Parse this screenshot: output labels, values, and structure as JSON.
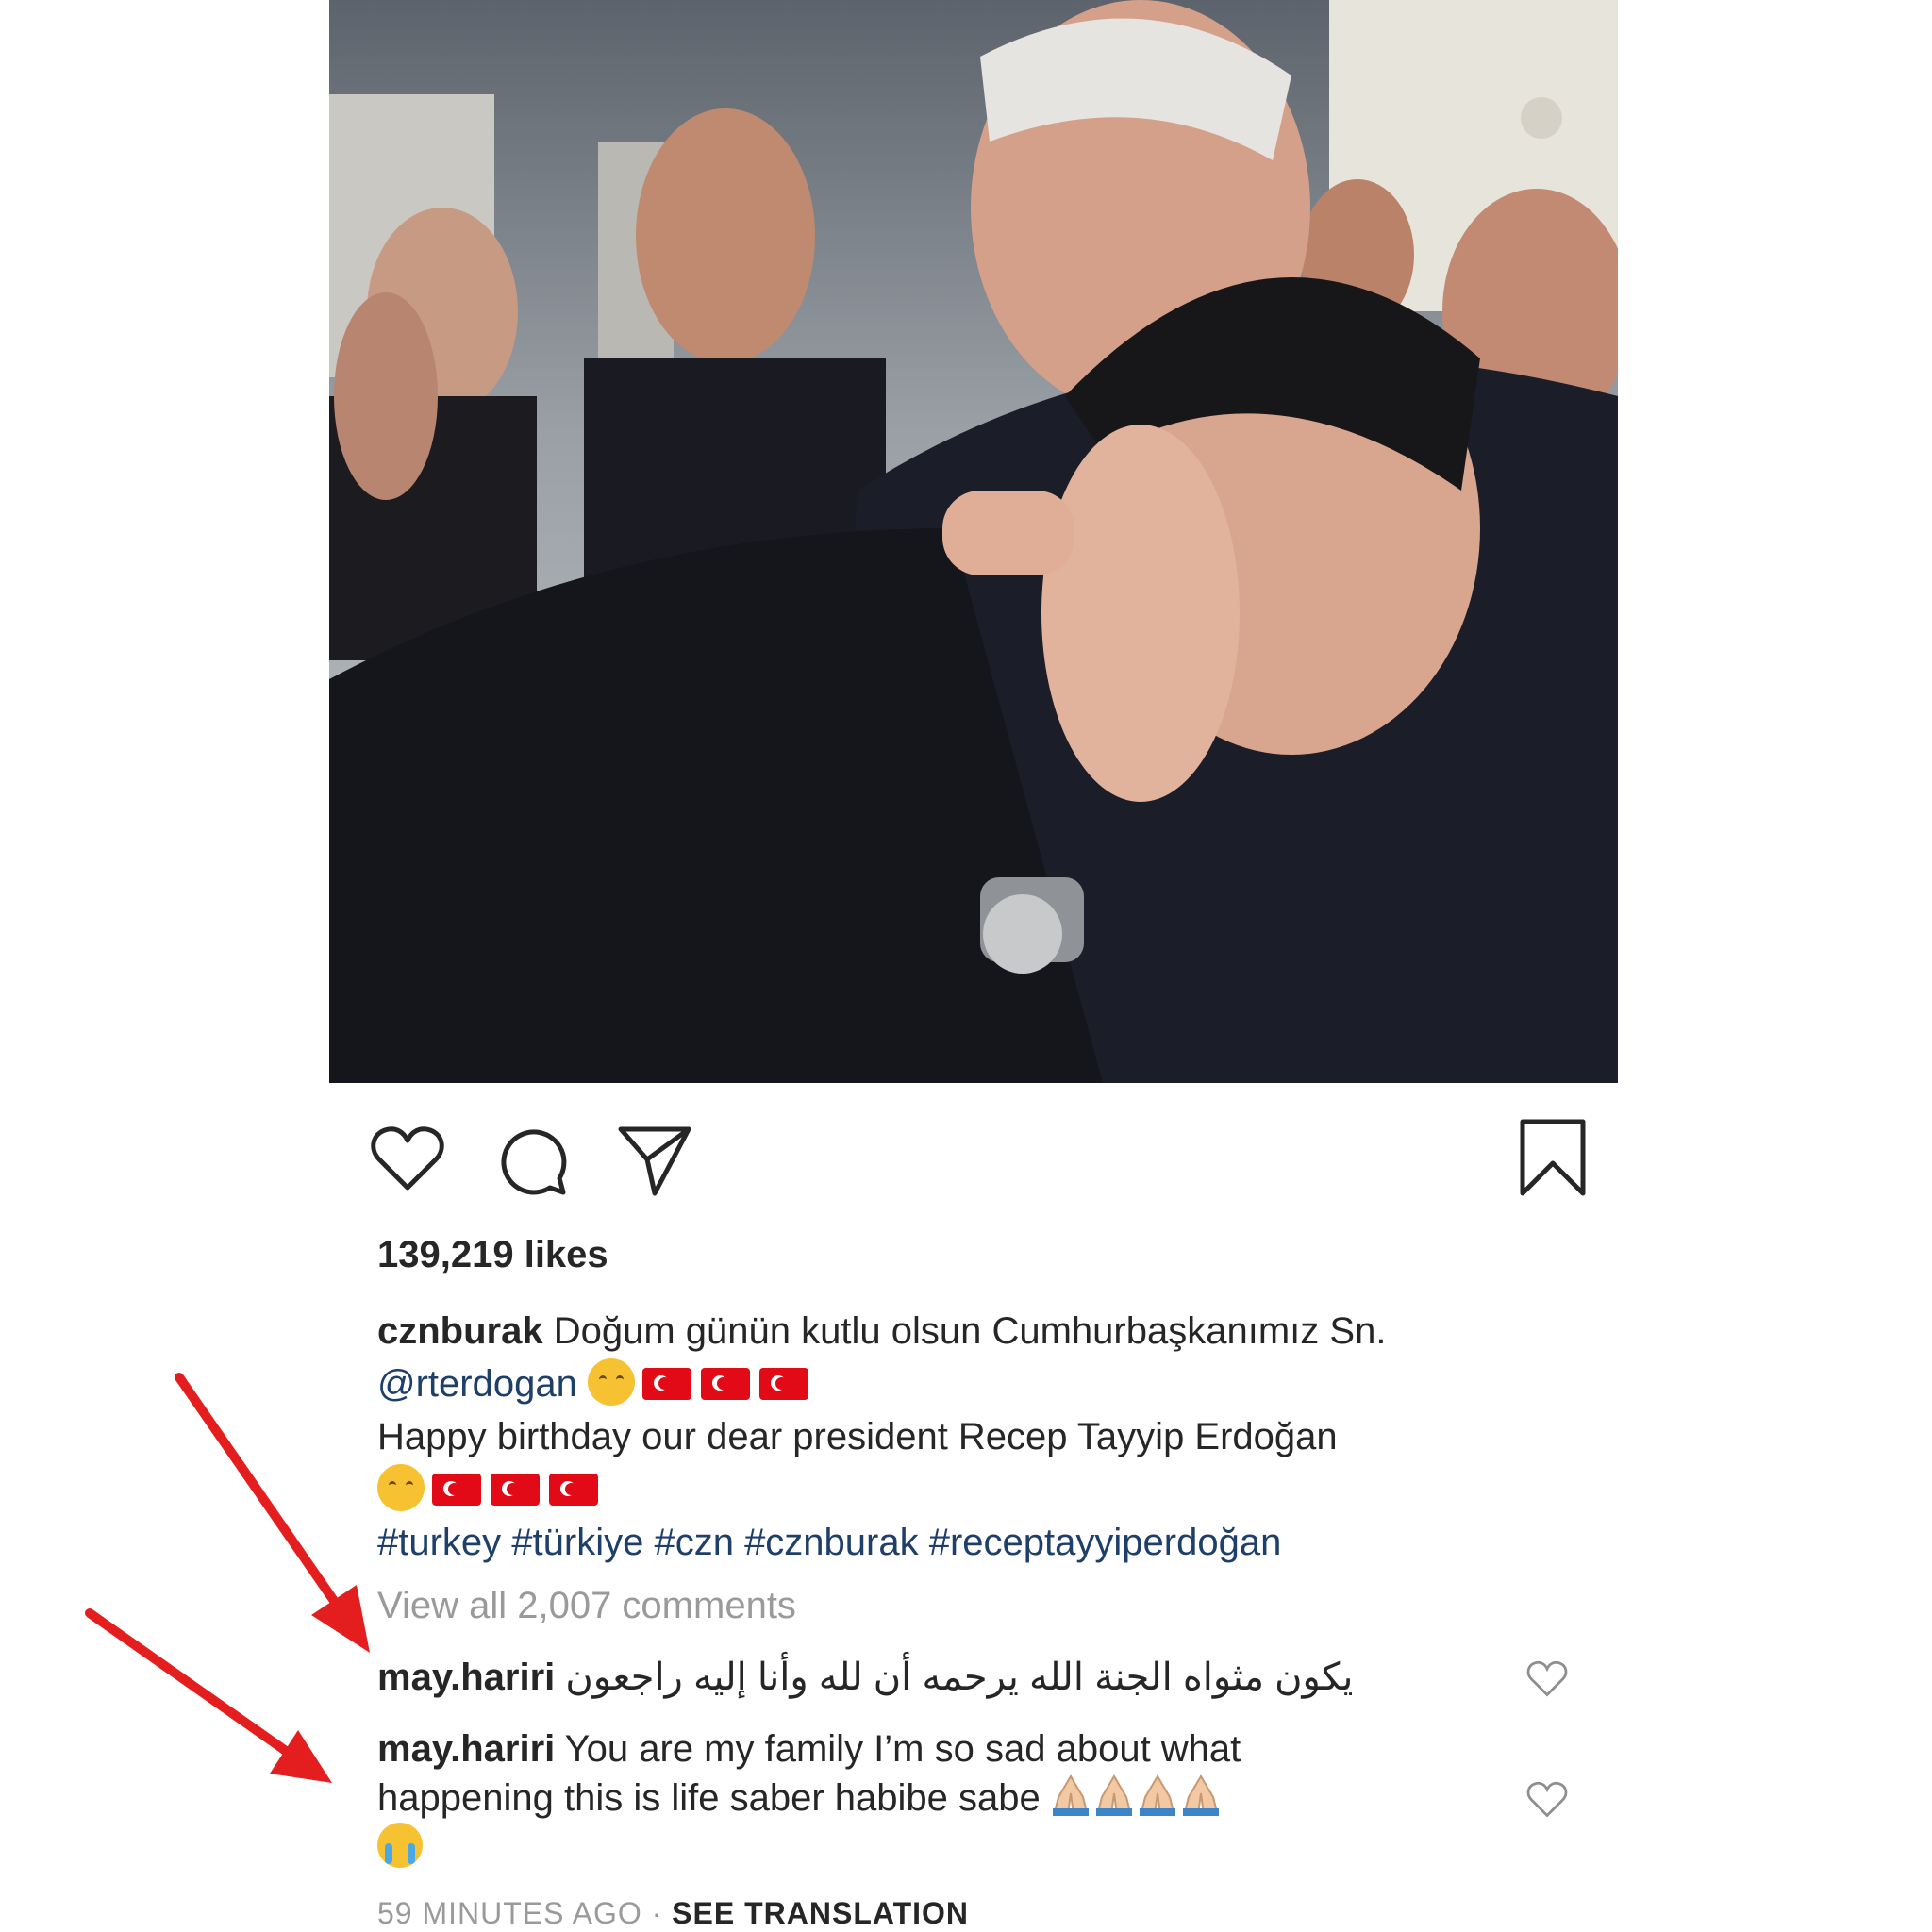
{
  "post": {
    "image_alt": "Two men embracing in a crowd",
    "likes": "139,219 likes",
    "caption": {
      "username": "cznburak",
      "line1_text": "Doğum günün kutlu olsun Cumhurbaşkanımız Sn.",
      "mention": "@rterdogan",
      "line3": "Happy birthday our dear president Recep Tayyip Erdoğan",
      "hashtags": "#turkey #türkiye #czn #cznburak #receptayyiperdoğan"
    },
    "view_all_comments": "View all 2,007 comments",
    "comments": [
      {
        "username": "may.hariri",
        "text": "يكون مثواه الجنة الله يرحمه أن لله وأنا إليه راجعون"
      },
      {
        "username": "may.hariri",
        "text_line1": "You are my family I’m so sad about what",
        "text_line2": "happening  this is life saber habibe sabe"
      }
    ],
    "timestamp": "59 MINUTES AGO",
    "separator": " · ",
    "see_translation": "SEE TRANSLATION"
  },
  "icons": [
    "heart-icon",
    "comment-icon",
    "share-icon",
    "bookmark-icon",
    "smiling-hug-emoji",
    "turkey-flag-emoji",
    "praying-hands-emoji",
    "crying-face-emoji",
    "red-arrow"
  ],
  "colors": {
    "text": "#262626",
    "link": "#1f3f6b",
    "muted": "#9a9a9a",
    "arrow": "#e41e1e"
  }
}
